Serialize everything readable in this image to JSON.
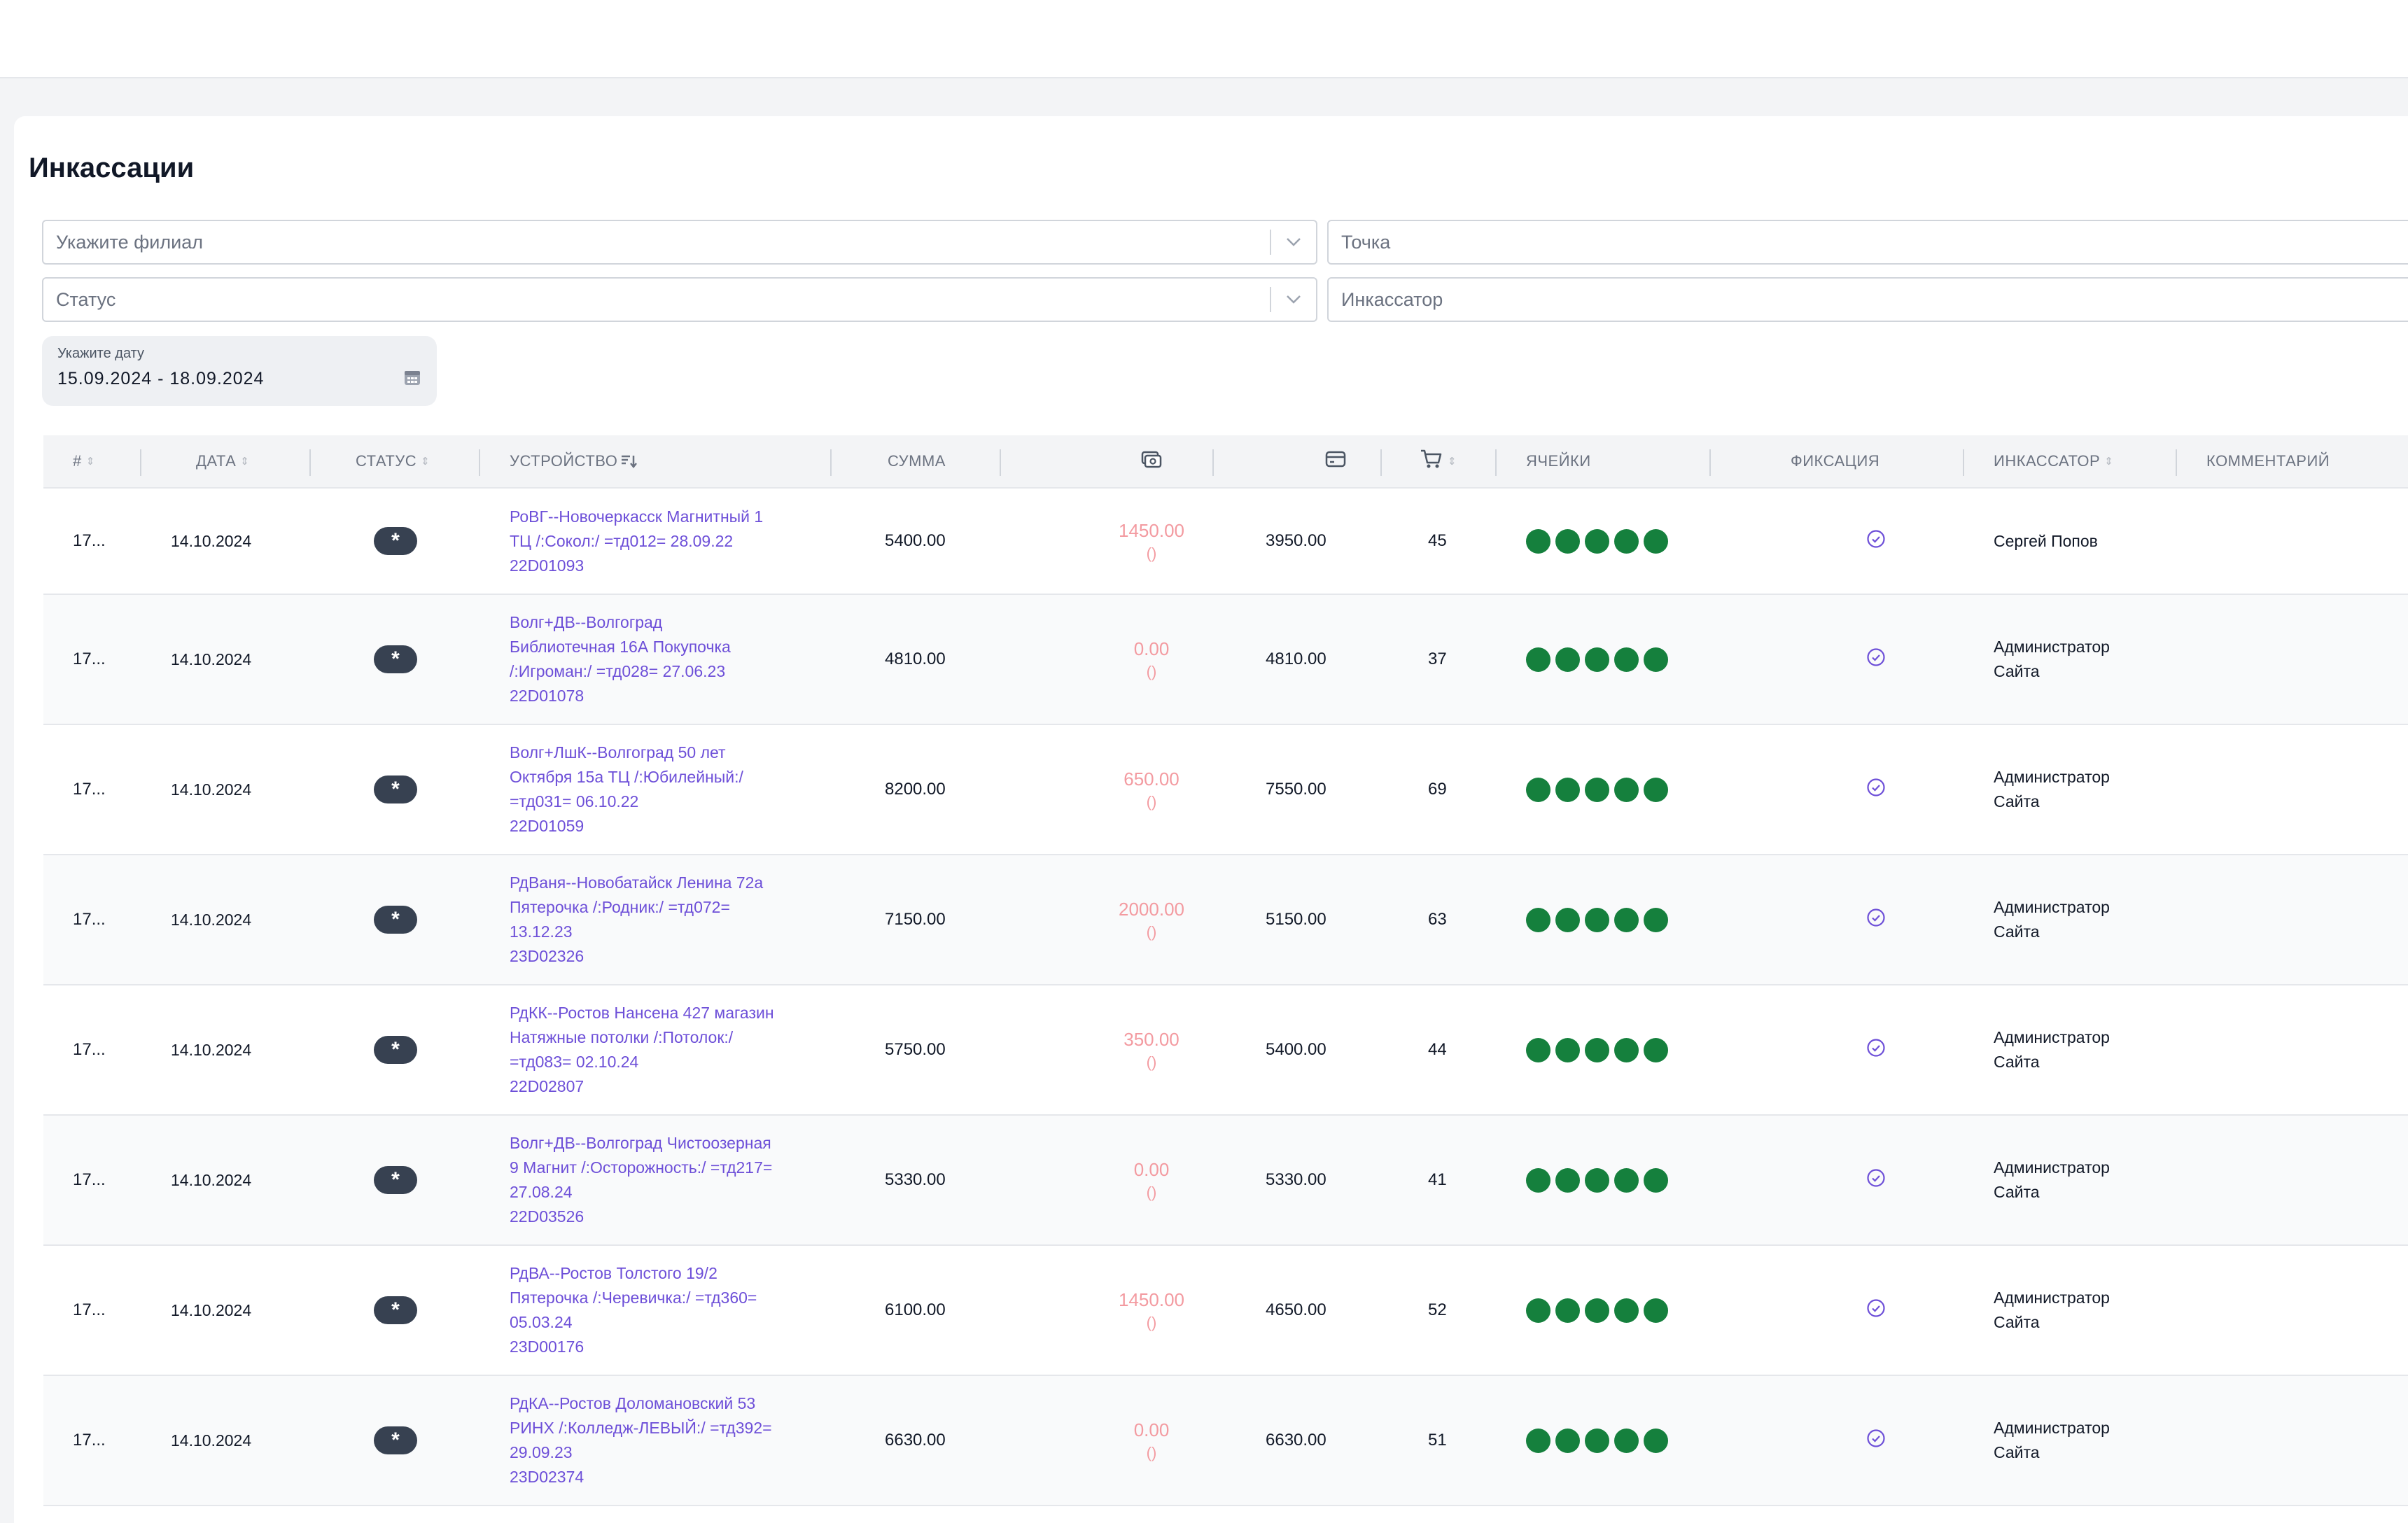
{
  "page": {
    "title": "Инкассации"
  },
  "filters": {
    "branch_placeholder": "Укажите филиал",
    "point_placeholder": "Точка",
    "status_placeholder": "Статус",
    "collector_placeholder": "Инкассатор",
    "date_label": "Укажите дату",
    "date_range": "15.09.2024 - 18.09.2024"
  },
  "table": {
    "columns": {
      "id": "#",
      "date": "Дата",
      "status": "Статус",
      "device": "Устройство",
      "sum": "Сумма",
      "cash_icon": "cash-icon",
      "card_icon": "card-icon",
      "cart_icon": "cart-icon",
      "cells": "Ячейки",
      "fixation": "Фиксация",
      "collector": "Инкассатор",
      "comment": "Комментарий"
    },
    "rows": [
      {
        "id": "17...",
        "date": "14.10.2024",
        "status": "*",
        "device": "РоВГ--Новочеркасск Магнитный 1\nТЦ /:Сокол:/ =тд012= 28.09.22\n22D01093",
        "sum": "5400.00",
        "cash": "1450.00",
        "cash_paren": "()",
        "card": "3950.00",
        "cart": "45",
        "cells_filled": 5,
        "collector": "Сергей Попов"
      },
      {
        "id": "17...",
        "date": "14.10.2024",
        "status": "*",
        "device": "Волг+ДВ--Волгоград\nБиблиотечная 16А Покупочка\n/:Игроман:/ =тд028= 27.06.23\n22D01078",
        "sum": "4810.00",
        "cash": "0.00",
        "cash_paren": "()",
        "card": "4810.00",
        "cart": "37",
        "cells_filled": 5,
        "collector": "Администратор\nСайта"
      },
      {
        "id": "17...",
        "date": "14.10.2024",
        "status": "*",
        "device": "Волг+ЛшК--Волгоград 50 лет\nОктября 15а ТЦ /:Юбилейный:/\n=тд031= 06.10.22\n22D01059",
        "sum": "8200.00",
        "cash": "650.00",
        "cash_paren": "()",
        "card": "7550.00",
        "cart": "69",
        "cells_filled": 5,
        "collector": "Администратор\nСайта"
      },
      {
        "id": "17...",
        "date": "14.10.2024",
        "status": "*",
        "device": "РдВаня--Новобатайск Ленина 72а\nПятерочка /:Родник:/ =тд072=\n13.12.23\n23D02326",
        "sum": "7150.00",
        "cash": "2000.00",
        "cash_paren": "()",
        "card": "5150.00",
        "cart": "63",
        "cells_filled": 5,
        "collector": "Администратор\nСайта"
      },
      {
        "id": "17...",
        "date": "14.10.2024",
        "status": "*",
        "device": "РдКК--Ростов Нансена 427 магазин\nНатяжные потолки /:Потолок:/\n=тд083= 02.10.24\n22D02807",
        "sum": "5750.00",
        "cash": "350.00",
        "cash_paren": "()",
        "card": "5400.00",
        "cart": "44",
        "cells_filled": 5,
        "collector": "Администратор\nСайта"
      },
      {
        "id": "17...",
        "date": "14.10.2024",
        "status": "*",
        "device": "Волг+ДВ--Волгоград Чистоозерная\n9 Магнит /:Осторожность:/ =тд217=\n27.08.24\n22D03526",
        "sum": "5330.00",
        "cash": "0.00",
        "cash_paren": "()",
        "card": "5330.00",
        "cart": "41",
        "cells_filled": 5,
        "collector": "Администратор\nСайта"
      },
      {
        "id": "17...",
        "date": "14.10.2024",
        "status": "*",
        "device": "РдВА--Ростов Толстого 19/2\nПятерочка /:Черевичка:/ =тд360=\n05.03.24\n23D00176",
        "sum": "6100.00",
        "cash": "1450.00",
        "cash_paren": "()",
        "card": "4650.00",
        "cart": "52",
        "cells_filled": 5,
        "collector": "Администратор\nСайта"
      },
      {
        "id": "17...",
        "date": "14.10.2024",
        "status": "*",
        "device": "РдКА--Ростов Доломановский 53\nРИНХ /:Колледж-ЛЕВЫЙ:/ =тд392=\n29.09.23\n23D02374",
        "sum": "6630.00",
        "cash": "0.00",
        "cash_paren": "()",
        "card": "6630.00",
        "cart": "51",
        "cells_filled": 5,
        "collector": "Администратор\nСайта"
      }
    ]
  },
  "colors": {
    "link": "#6d4fd8",
    "cash_text": "#f39aa0",
    "cell_dot": "#15803d",
    "status_badge": "#374151",
    "fixation_icon": "#6d4fd8"
  }
}
